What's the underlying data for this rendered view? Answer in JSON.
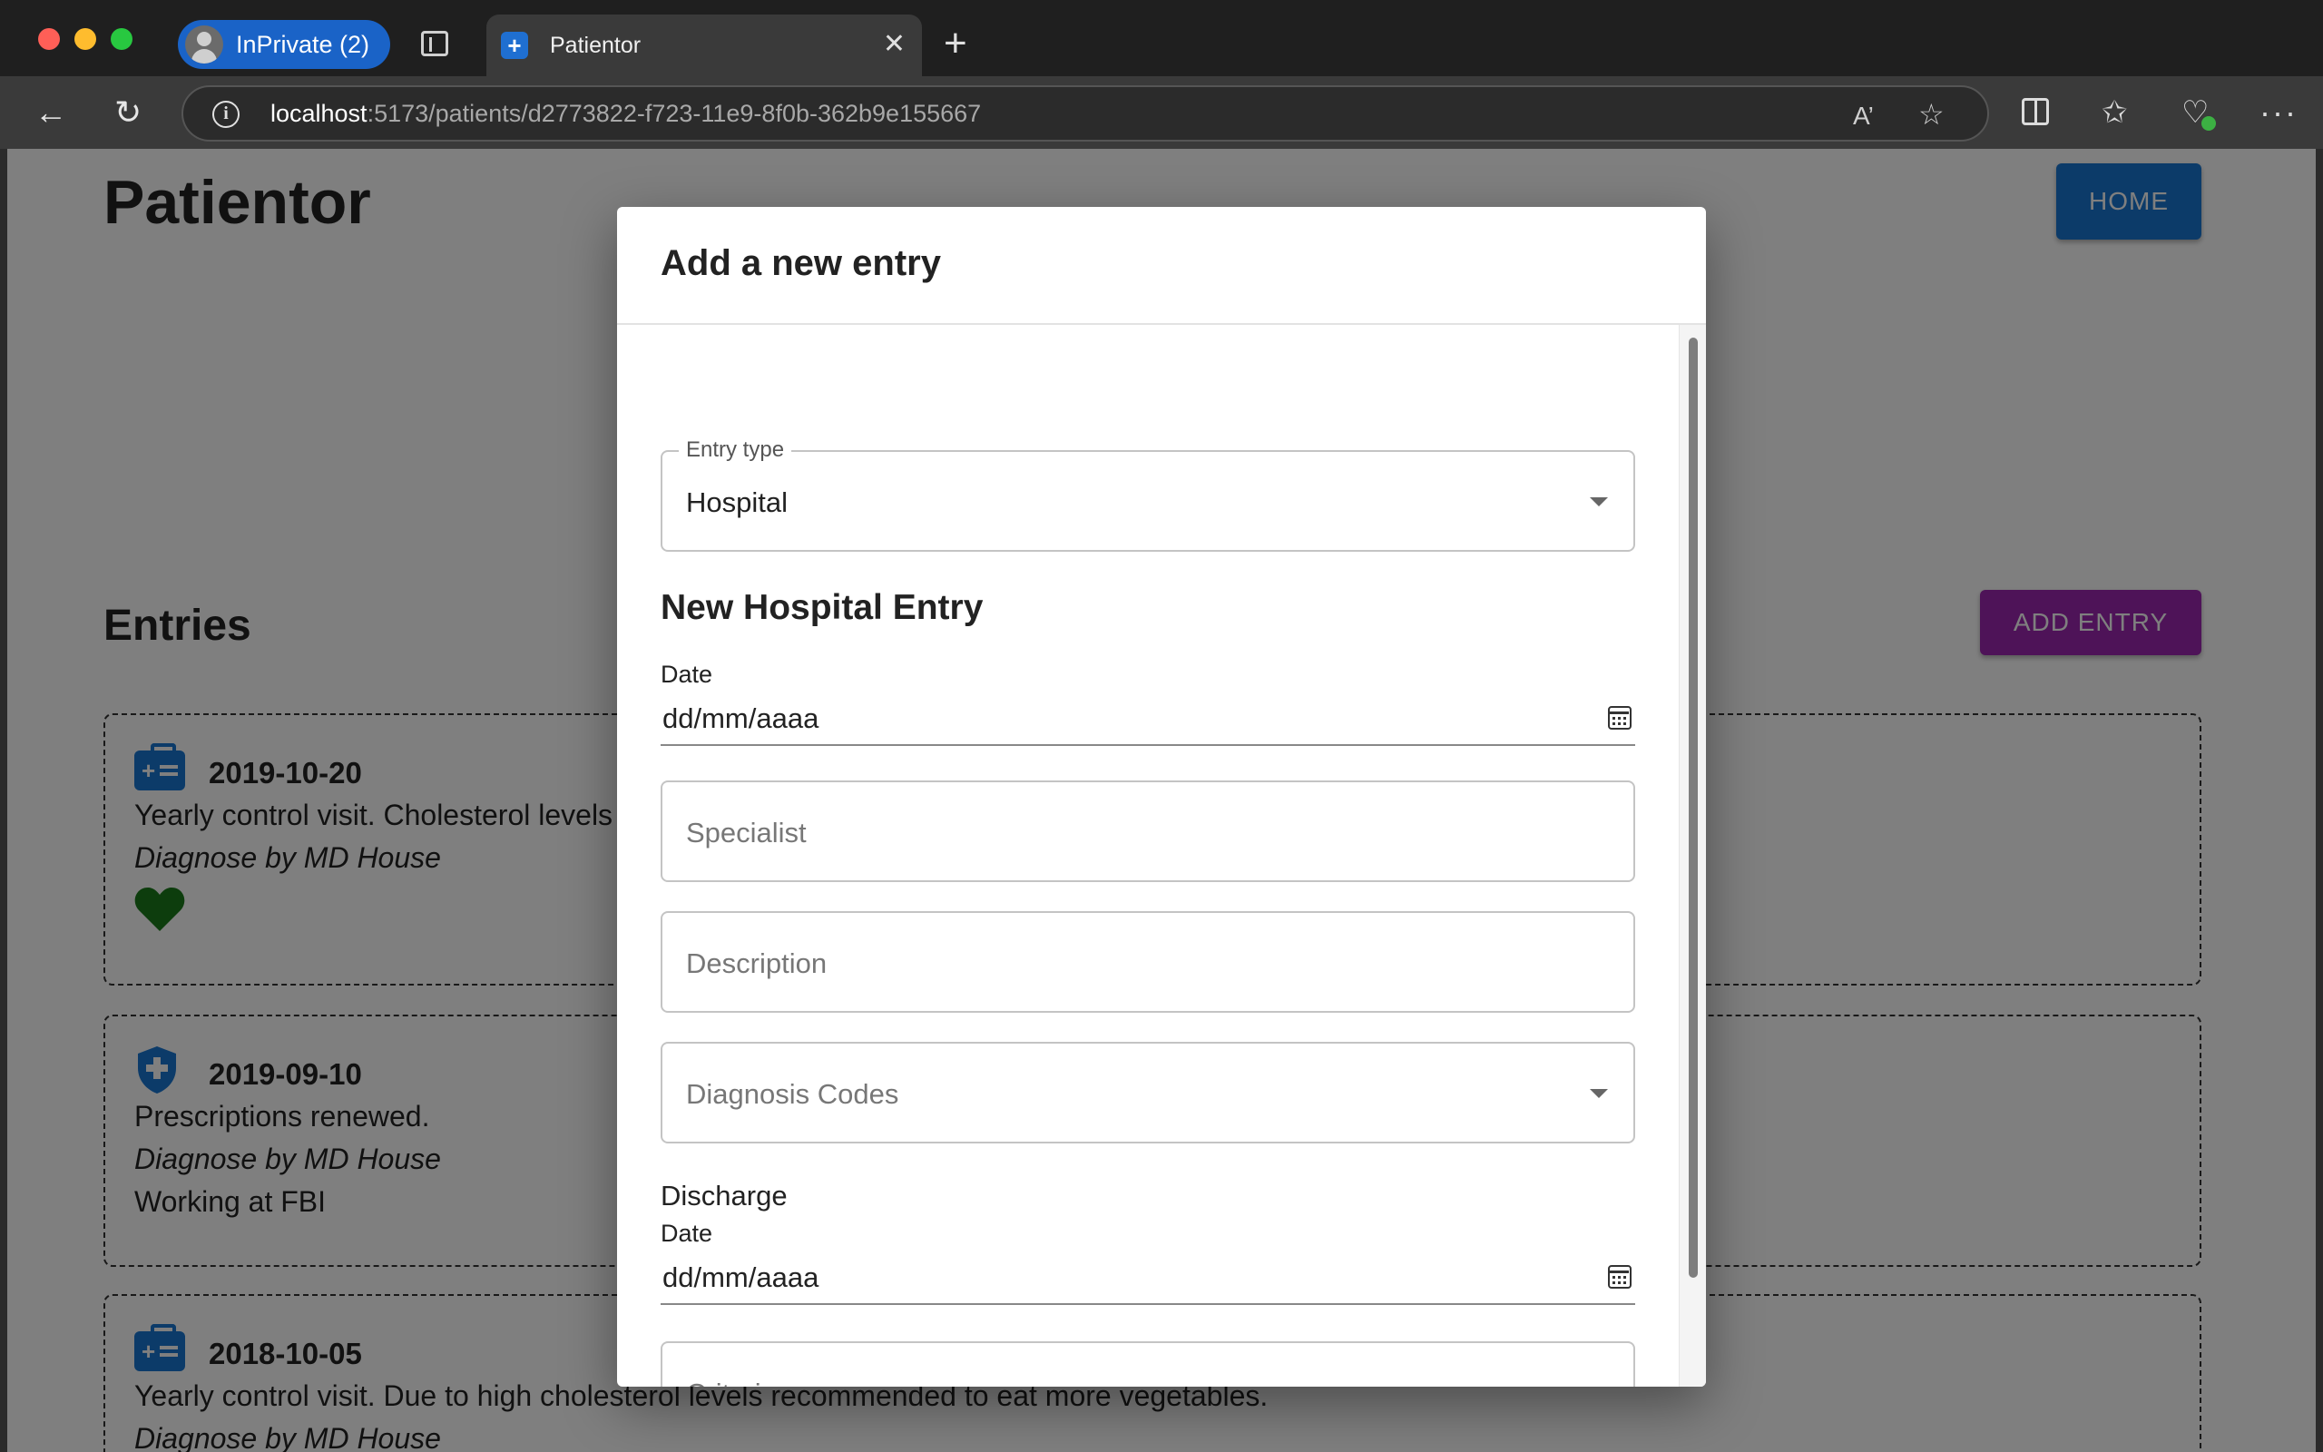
{
  "browser": {
    "profile_label": "InPrivate (2)",
    "tab_title": "Patientor",
    "url_host": "localhost",
    "url_path": ":5173/patients/d2773822-f723-11e9-8f0b-362b9e155667"
  },
  "app": {
    "title": "Patientor",
    "home_button": "HOME",
    "entries_heading": "Entries",
    "add_entry_button": "ADD ENTRY"
  },
  "entries": [
    {
      "date": "2019-10-20",
      "icon": "medical-badge-icon",
      "description": "Yearly control visit. Cholesterol levels",
      "diagnose": "Diagnose by MD House",
      "health_rating_icon": "heart-icon",
      "health_rating_color": "#1b7a1b"
    },
    {
      "date": "2019-09-10",
      "icon": "medical-shield-icon",
      "description": "Prescriptions renewed.",
      "diagnose": "Diagnose by MD House",
      "employer": "Working at FBI"
    },
    {
      "date": "2018-10-05",
      "icon": "medical-badge-icon",
      "description": "Yearly control visit. Due to high cholesterol levels recommended to eat more vegetables.",
      "diagnose": "Diagnose by MD House"
    }
  ],
  "dialog": {
    "title": "Add a new entry",
    "entry_type_label": "Entry type",
    "entry_type_value": "Hospital",
    "section_title": "New Hospital Entry",
    "date_label": "Date",
    "date_placeholder": "dd/mm/aaaa",
    "specialist_placeholder": "Specialist",
    "description_placeholder": "Description",
    "diagnosis_codes_placeholder": "Diagnosis Codes",
    "discharge_title": "Discharge",
    "discharge_date_label": "Date",
    "discharge_date_placeholder": "dd/mm/aaaa",
    "criteria_placeholder": "Criteria"
  },
  "colors": {
    "primary": "#1976d2",
    "secondary": "#9c27b0",
    "error": "#d32f2f"
  }
}
